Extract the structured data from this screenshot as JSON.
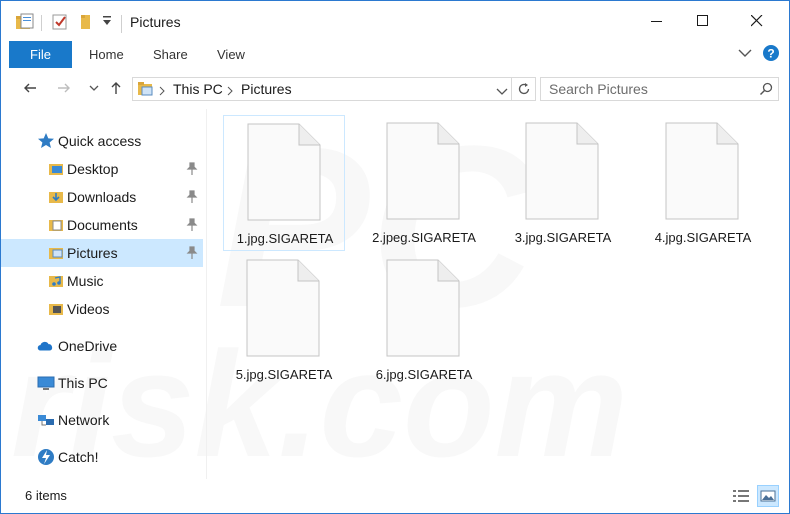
{
  "window": {
    "title": "Pictures",
    "controls": {
      "minimize": "minimize",
      "maximize": "maximize",
      "close": "close"
    }
  },
  "ribbon": {
    "tabs": [
      "File",
      "Home",
      "Share",
      "View"
    ]
  },
  "address": {
    "crumbs": [
      "This PC",
      "Pictures"
    ]
  },
  "search": {
    "placeholder": "Search Pictures"
  },
  "nav": {
    "quick_access": "Quick access",
    "items": [
      {
        "label": "Desktop",
        "icon": "desktop-folder-icon",
        "pinned": true
      },
      {
        "label": "Downloads",
        "icon": "downloads-folder-icon",
        "pinned": true
      },
      {
        "label": "Documents",
        "icon": "documents-folder-icon",
        "pinned": true
      },
      {
        "label": "Pictures",
        "icon": "pictures-folder-icon",
        "pinned": true,
        "selected": true
      },
      {
        "label": "Music",
        "icon": "music-folder-icon",
        "pinned": false
      },
      {
        "label": "Videos",
        "icon": "videos-folder-icon",
        "pinned": false
      }
    ],
    "onedrive": "OneDrive",
    "this_pc": "This PC",
    "network": "Network",
    "catch": "Catch!"
  },
  "files": [
    {
      "name": "1.jpg.SIGARETA"
    },
    {
      "name": "2.jpeg.SIGARETA"
    },
    {
      "name": "3.jpg.SIGARETA"
    },
    {
      "name": "4.jpg.SIGARETA"
    },
    {
      "name": "5.jpg.SIGARETA"
    },
    {
      "name": "6.jpg.SIGARETA"
    }
  ],
  "status": {
    "count": "6 items"
  },
  "colors": {
    "accent": "#1979ca",
    "selection": "#cce8ff",
    "folder": "#e8b94a",
    "border": "#2b79d0"
  },
  "watermark": "PC risk.com"
}
